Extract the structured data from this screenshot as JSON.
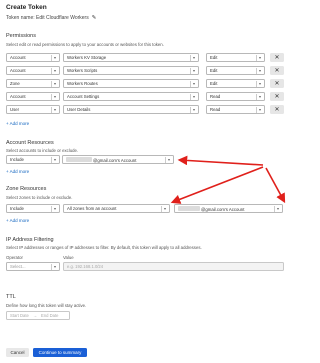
{
  "page": {
    "title": "Create Token",
    "token_name": "Token name: Edit Cloudflare Workers"
  },
  "permissions": {
    "heading": "Permissions",
    "helper": "Select edit or read permissions to apply to your accounts or websites for this token.",
    "rows": [
      {
        "scope": "Account",
        "resource": "Workers KV Storage",
        "access": "Edit"
      },
      {
        "scope": "Account",
        "resource": "Workers Scripts",
        "access": "Edit"
      },
      {
        "scope": "Zone",
        "resource": "Workers Routes",
        "access": "Edit"
      },
      {
        "scope": "Account",
        "resource": "Account Settings",
        "access": "Read"
      },
      {
        "scope": "User",
        "resource": "User Details",
        "access": "Read"
      }
    ],
    "remove_glyph": "✕",
    "add_more": "+ Add more"
  },
  "account_resources": {
    "heading": "Account Resources",
    "helper": "Select accounts to include or exclude.",
    "include": "Include",
    "account": "@gmail.com's Account",
    "add_more": "+ Add more"
  },
  "zone_resources": {
    "heading": "Zone Resources",
    "helper": "Select zones to include or exclude.",
    "include": "Include",
    "zones": "All zones from an account",
    "account": "@gmail.com's Account",
    "add_more": "+ Add more"
  },
  "ip_filtering": {
    "heading": "IP Address Filtering",
    "helper": "Select IP addresses or ranges of IP addresses to filter. By default, this token will apply to all addresses.",
    "operator_label": "Operator",
    "value_label": "Value",
    "operator_placeholder": "Select...",
    "value_placeholder": "e.g. 192.168.1.0/24"
  },
  "ttl": {
    "heading": "TTL",
    "helper": "Define how long this token will stay active.",
    "start": "Start Date",
    "arrow": "→",
    "end": "End Date"
  },
  "actions": {
    "cancel": "Cancel",
    "continue": "Continue to summary"
  },
  "colors": {
    "accent": "#1a5fd6",
    "arrow": "#e0201b",
    "link": "#1466c0"
  },
  "icons": {
    "pencil": "pencil-icon",
    "chevron": "chevron-down-icon",
    "close": "close-icon",
    "calendar_arrow": "arrow-right-icon"
  }
}
